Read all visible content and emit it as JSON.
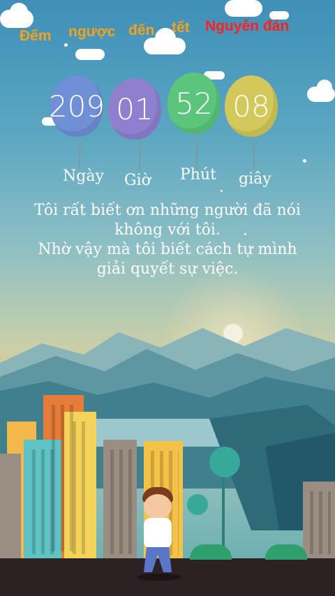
{
  "title": {
    "words": [
      "Đếm",
      "ngược",
      "đến",
      "tết",
      "Nguyên đán"
    ],
    "colors": [
      "#f2a21b",
      "#f2a21b",
      "#f2a21b",
      "#f2a21b",
      "#ff1f1f"
    ]
  },
  "countdown": [
    {
      "value": "209",
      "unit": "Ngày",
      "color": "#6f8fd6"
    },
    {
      "value": "01",
      "unit": "Giờ",
      "color": "#8f7fcf"
    },
    {
      "value": "52",
      "unit": "Phút",
      "color": "#5cc57c"
    },
    {
      "value": "08",
      "unit": "giây",
      "color": "#d3c85a"
    }
  ],
  "quote": {
    "line1": "Tôi rất biết ơn những người đã nói",
    "line2": "không với tôi.",
    "line3": "Nhờ vậy mà tôi biết cách tự mình",
    "line4": "giải quyết sự việc."
  }
}
